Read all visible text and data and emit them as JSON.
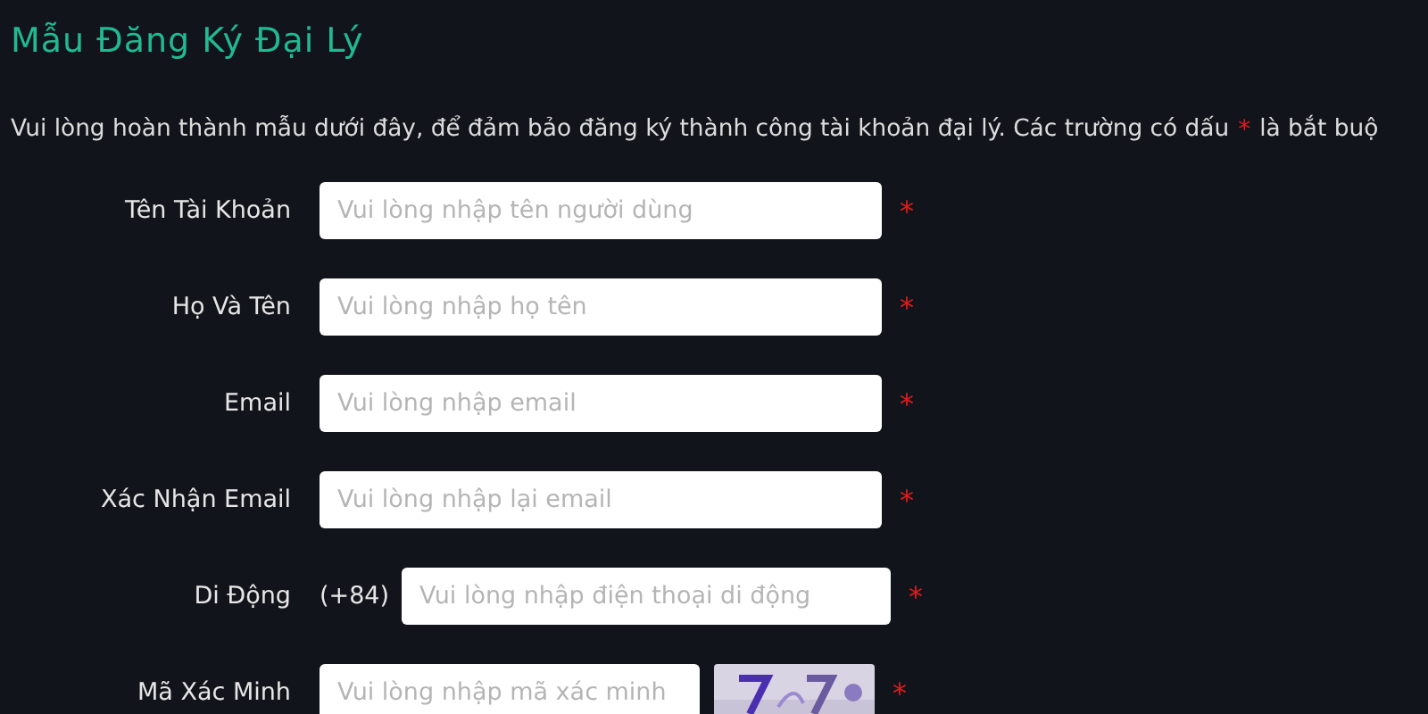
{
  "title": "Mẫu Đăng Ký Đại Lý",
  "intro": {
    "before": "Vui lòng hoàn thành mẫu dưới đây, để đảm bảo đăng ký thành công tài khoản đại lý. Các trường có dấu",
    "mark": "*",
    "after": "là bắt buộ"
  },
  "fields": [
    {
      "kind": "text",
      "label": "Tên Tài Khoản",
      "placeholder": "Vui lòng nhập tên người dùng",
      "required_mark": "*"
    },
    {
      "kind": "text",
      "label": "Họ Và Tên",
      "placeholder": "Vui lòng nhập họ tên",
      "required_mark": "*"
    },
    {
      "kind": "text",
      "label": "Email",
      "placeholder": "Vui lòng nhập email",
      "required_mark": "*"
    },
    {
      "kind": "text",
      "label": "Xác Nhận Email",
      "placeholder": "Vui lòng nhập lại email",
      "required_mark": "*"
    },
    {
      "kind": "phone",
      "label": "Di Động",
      "prefix": "(+84)",
      "placeholder": "Vui lòng nhập điện thoại di động",
      "required_mark": "*"
    },
    {
      "kind": "captcha",
      "label": "Mã Xác Minh",
      "placeholder": "Vui lòng nhập mã xác minh",
      "required_mark": "*"
    }
  ]
}
